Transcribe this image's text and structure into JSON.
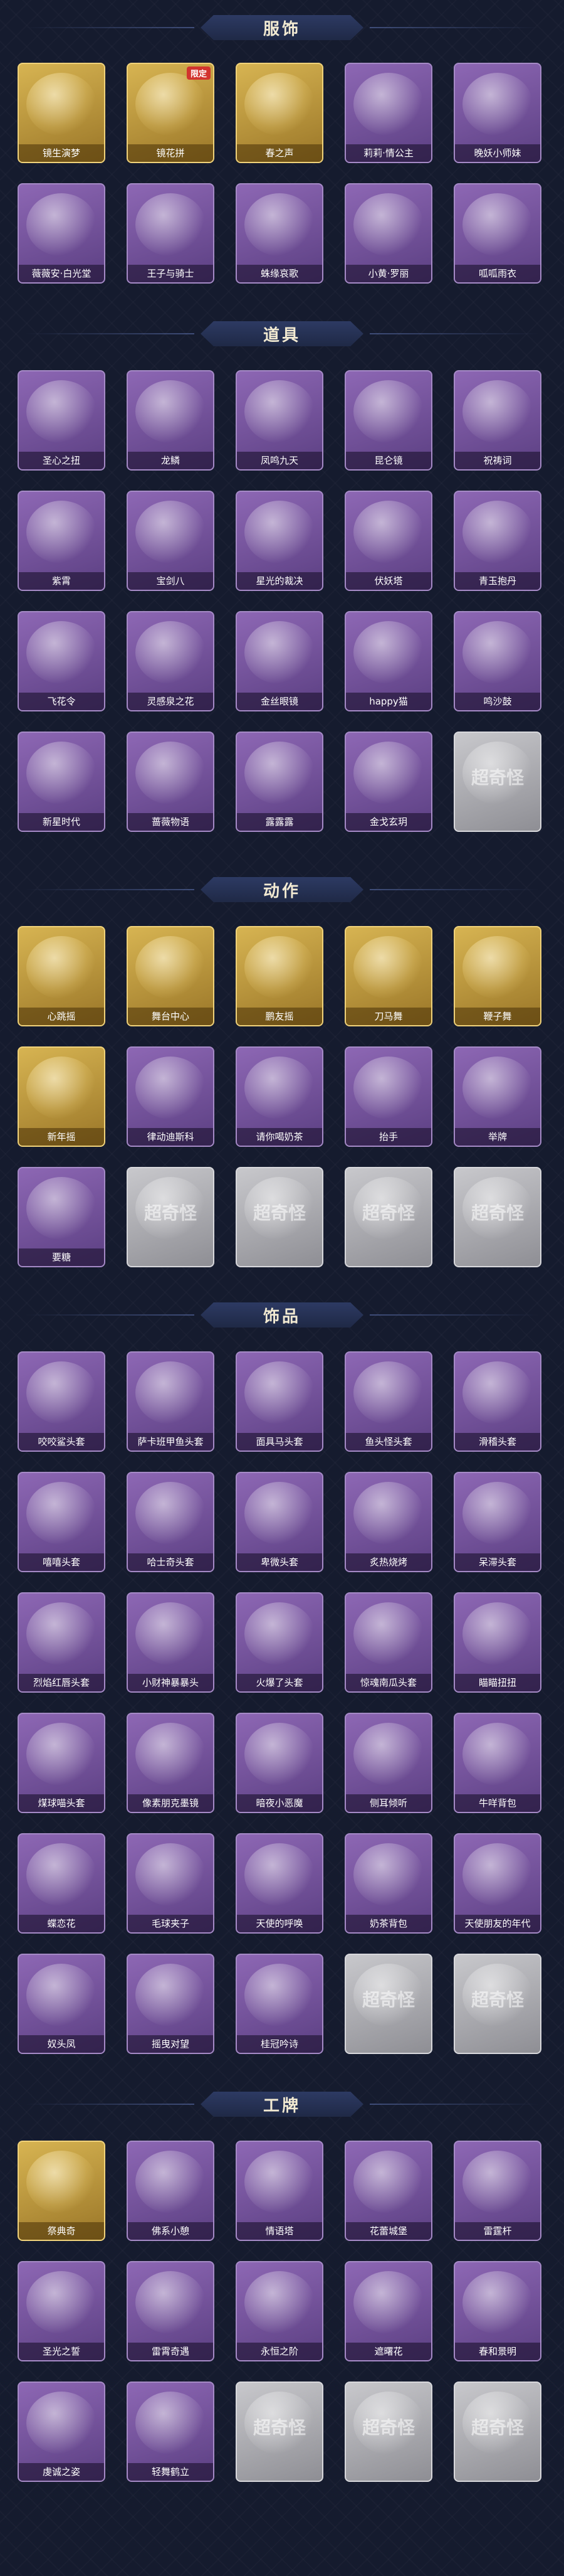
{
  "sections": [
    {
      "id": "clothing",
      "title": "服饰",
      "items": [
        {
          "label": "镜生演梦",
          "style": "gold",
          "tag": "",
          "icon": "costume-icon"
        },
        {
          "label": "镜花拼",
          "style": "gold",
          "tag": "限定",
          "icon": "costume-icon"
        },
        {
          "label": "春之声",
          "style": "gold",
          "tag": "",
          "icon": "costume-icon"
        },
        {
          "label": "莉莉·情公主",
          "style": "purple",
          "tag": "",
          "icon": "costume-icon"
        },
        {
          "label": "晚妖小师妹",
          "style": "purple",
          "tag": "",
          "icon": "costume-icon"
        },
        {
          "label": "薇薇安·白光堂",
          "style": "purple",
          "tag": "",
          "icon": "costume-icon"
        },
        {
          "label": "王子与骑士",
          "style": "purple",
          "tag": "",
          "icon": "costume-icon"
        },
        {
          "label": "蛛缘哀歌",
          "style": "purple",
          "tag": "",
          "icon": "costume-icon"
        },
        {
          "label": "小黄·罗丽",
          "style": "purple",
          "tag": "",
          "icon": "costume-icon"
        },
        {
          "label": "呱呱雨衣",
          "style": "purple",
          "tag": "",
          "icon": "costume-icon"
        }
      ]
    },
    {
      "id": "props",
      "title": "道具",
      "items": [
        {
          "label": "圣心之扭",
          "style": "purple",
          "tag": "",
          "icon": "prop-icon"
        },
        {
          "label": "龙鳞",
          "style": "purple",
          "tag": "",
          "icon": "prop-icon"
        },
        {
          "label": "凤鸣九天",
          "style": "purple",
          "tag": "",
          "icon": "prop-icon"
        },
        {
          "label": "昆仑镜",
          "style": "purple",
          "tag": "",
          "icon": "prop-icon"
        },
        {
          "label": "祝祷词",
          "style": "purple",
          "tag": "",
          "icon": "prop-icon"
        },
        {
          "label": "紫霄",
          "style": "purple",
          "tag": "",
          "icon": "prop-icon"
        },
        {
          "label": "宝剑八",
          "style": "purple",
          "tag": "",
          "icon": "prop-icon"
        },
        {
          "label": "星光的裁决",
          "style": "purple",
          "tag": "",
          "icon": "prop-icon"
        },
        {
          "label": "伏妖塔",
          "style": "purple",
          "tag": "",
          "icon": "prop-icon"
        },
        {
          "label": "青玉抱丹",
          "style": "purple",
          "tag": "",
          "icon": "prop-icon"
        },
        {
          "label": "飞花令",
          "style": "purple",
          "tag": "",
          "icon": "prop-icon"
        },
        {
          "label": "灵感泉之花",
          "style": "purple",
          "tag": "",
          "icon": "prop-icon"
        },
        {
          "label": "金丝眼镜",
          "style": "purple",
          "tag": "",
          "icon": "prop-icon"
        },
        {
          "label": "happy猫",
          "style": "purple",
          "tag": "",
          "icon": "prop-icon"
        },
        {
          "label": "鸣沙鼓",
          "style": "purple",
          "tag": "",
          "icon": "prop-icon"
        },
        {
          "label": "新星时代",
          "style": "purple",
          "tag": "",
          "icon": "prop-icon"
        },
        {
          "label": "蔷薇物语",
          "style": "purple",
          "tag": "",
          "icon": "prop-icon"
        },
        {
          "label": "露露露",
          "style": "purple",
          "tag": "",
          "icon": "prop-icon"
        },
        {
          "label": "金戈玄玥",
          "style": "purple",
          "tag": "",
          "icon": "prop-icon"
        },
        {
          "label": "",
          "style": "empty",
          "tag": "",
          "icon": "placeholder-icon"
        }
      ]
    },
    {
      "id": "actions",
      "title": "动作",
      "items": [
        {
          "label": "心跳摇",
          "style": "gold",
          "tag": "",
          "icon": "pose-icon"
        },
        {
          "label": "舞台中心",
          "style": "gold",
          "tag": "",
          "icon": "pose-icon"
        },
        {
          "label": "鹏友摇",
          "style": "gold",
          "tag": "",
          "icon": "pose-icon"
        },
        {
          "label": "刀马舞",
          "style": "gold",
          "tag": "",
          "icon": "pose-icon"
        },
        {
          "label": "鞭子舞",
          "style": "gold",
          "tag": "",
          "icon": "pose-icon"
        },
        {
          "label": "新年摇",
          "style": "gold",
          "tag": "",
          "icon": "pose-icon"
        },
        {
          "label": "律动迪斯科",
          "style": "purple",
          "tag": "",
          "icon": "pose-icon"
        },
        {
          "label": "请你喝奶茶",
          "style": "purple",
          "tag": "",
          "icon": "pose-icon"
        },
        {
          "label": "抬手",
          "style": "purple",
          "tag": "",
          "icon": "pose-icon"
        },
        {
          "label": "举牌",
          "style": "purple",
          "tag": "",
          "icon": "pose-icon"
        },
        {
          "label": "要糖",
          "style": "purple",
          "tag": "",
          "icon": "pose-icon"
        },
        {
          "label": "",
          "style": "empty",
          "tag": "",
          "icon": "placeholder-icon"
        },
        {
          "label": "",
          "style": "empty",
          "tag": "",
          "icon": "placeholder-icon"
        },
        {
          "label": "",
          "style": "empty",
          "tag": "",
          "icon": "placeholder-icon"
        },
        {
          "label": "",
          "style": "empty",
          "tag": "",
          "icon": "placeholder-icon"
        }
      ]
    },
    {
      "id": "accessories",
      "title": "饰品",
      "items": [
        {
          "label": "咬咬鲨头套",
          "style": "purple",
          "tag": "",
          "icon": "headgear-icon"
        },
        {
          "label": "萨卡班甲鱼头套",
          "style": "purple",
          "tag": "",
          "icon": "headgear-icon"
        },
        {
          "label": "面具马头套",
          "style": "purple",
          "tag": "",
          "icon": "headgear-icon"
        },
        {
          "label": "鱼头怪头套",
          "style": "purple",
          "tag": "",
          "icon": "headgear-icon"
        },
        {
          "label": "滑稽头套",
          "style": "purple",
          "tag": "",
          "icon": "headgear-icon"
        },
        {
          "label": "嘻嘻头套",
          "style": "purple",
          "tag": "",
          "icon": "headgear-icon"
        },
        {
          "label": "哈士奇头套",
          "style": "purple",
          "tag": "",
          "icon": "headgear-icon"
        },
        {
          "label": "卑微头套",
          "style": "purple",
          "tag": "",
          "icon": "headgear-icon"
        },
        {
          "label": "炙热烧烤",
          "style": "purple",
          "tag": "",
          "icon": "headgear-icon"
        },
        {
          "label": "呆滞头套",
          "style": "purple",
          "tag": "",
          "icon": "headgear-icon"
        },
        {
          "label": "烈焰红唇头套",
          "style": "purple",
          "tag": "",
          "icon": "headgear-icon"
        },
        {
          "label": "小财神暴暴头",
          "style": "purple",
          "tag": "",
          "icon": "headgear-icon"
        },
        {
          "label": "火爆了头套",
          "style": "purple",
          "tag": "",
          "icon": "headgear-icon"
        },
        {
          "label": "惊魂南瓜头套",
          "style": "purple",
          "tag": "",
          "icon": "headgear-icon"
        },
        {
          "label": "瞄瞄扭扭",
          "style": "purple",
          "tag": "",
          "icon": "headgear-icon"
        },
        {
          "label": "煤球喵头套",
          "style": "purple",
          "tag": "",
          "icon": "headgear-icon"
        },
        {
          "label": "像素朋克墨镜",
          "style": "purple",
          "tag": "",
          "icon": "headgear-icon"
        },
        {
          "label": "暗夜小恶魔",
          "style": "purple",
          "tag": "",
          "icon": "headgear-icon"
        },
        {
          "label": "侧耳倾听",
          "style": "purple",
          "tag": "",
          "icon": "headgear-icon"
        },
        {
          "label": "牛咩背包",
          "style": "purple",
          "tag": "",
          "icon": "headgear-icon"
        },
        {
          "label": "蝶恋花",
          "style": "purple",
          "tag": "",
          "icon": "headgear-icon"
        },
        {
          "label": "毛球夹子",
          "style": "purple",
          "tag": "",
          "icon": "headgear-icon"
        },
        {
          "label": "天使的呼唤",
          "style": "purple",
          "tag": "",
          "icon": "headgear-icon"
        },
        {
          "label": "奶茶背包",
          "style": "purple",
          "tag": "",
          "icon": "headgear-icon"
        },
        {
          "label": "天使朋友的年代",
          "style": "purple",
          "tag": "",
          "icon": "headgear-icon"
        },
        {
          "label": "奴头凤",
          "style": "purple",
          "tag": "",
          "icon": "headgear-icon"
        },
        {
          "label": "摇曳对望",
          "style": "purple",
          "tag": "",
          "icon": "headgear-icon"
        },
        {
          "label": "桂冠吟诗",
          "style": "purple",
          "tag": "",
          "icon": "headgear-icon"
        },
        {
          "label": "",
          "style": "empty",
          "tag": "",
          "icon": "placeholder-icon"
        },
        {
          "label": "",
          "style": "empty",
          "tag": "",
          "icon": "placeholder-icon"
        }
      ]
    },
    {
      "id": "badges",
      "title": "工牌",
      "items": [
        {
          "label": "祭典奇",
          "style": "gold",
          "tag": "",
          "icon": "card-icon"
        },
        {
          "label": "佛系小憩",
          "style": "purple",
          "tag": "",
          "icon": "card-icon"
        },
        {
          "label": "情语塔",
          "style": "purple",
          "tag": "",
          "icon": "card-icon"
        },
        {
          "label": "花蕾城堡",
          "style": "purple",
          "tag": "",
          "icon": "card-icon"
        },
        {
          "label": "雷霆杆",
          "style": "purple",
          "tag": "",
          "icon": "card-icon"
        },
        {
          "label": "圣光之誓",
          "style": "purple",
          "tag": "",
          "icon": "card-icon"
        },
        {
          "label": "雷霄奇遇",
          "style": "purple",
          "tag": "",
          "icon": "card-icon"
        },
        {
          "label": "永恒之阶",
          "style": "purple",
          "tag": "",
          "icon": "card-icon"
        },
        {
          "label": "遮曙花",
          "style": "purple",
          "tag": "",
          "icon": "card-icon"
        },
        {
          "label": "春和景明",
          "style": "purple",
          "tag": "",
          "icon": "card-icon"
        },
        {
          "label": "虔诚之姿",
          "style": "purple",
          "tag": "",
          "icon": "card-icon"
        },
        {
          "label": "轻舞鹤立",
          "style": "purple",
          "tag": "",
          "icon": "card-icon"
        },
        {
          "label": "",
          "style": "empty",
          "tag": "",
          "icon": "placeholder-icon"
        },
        {
          "label": "",
          "style": "empty",
          "tag": "",
          "icon": "placeholder-icon"
        },
        {
          "label": "",
          "style": "empty",
          "tag": "",
          "icon": "placeholder-icon"
        }
      ]
    }
  ],
  "placeholder_watermark": "超奇怪",
  "colors": {
    "background": "#151b2e",
    "header_badge": "#2d3a63",
    "header_text": "#f2ead2",
    "card_purple": "#8d67b4",
    "card_gold": "#d7b452",
    "card_empty": "#c8c8cc",
    "tag_red": "#d2342e"
  }
}
